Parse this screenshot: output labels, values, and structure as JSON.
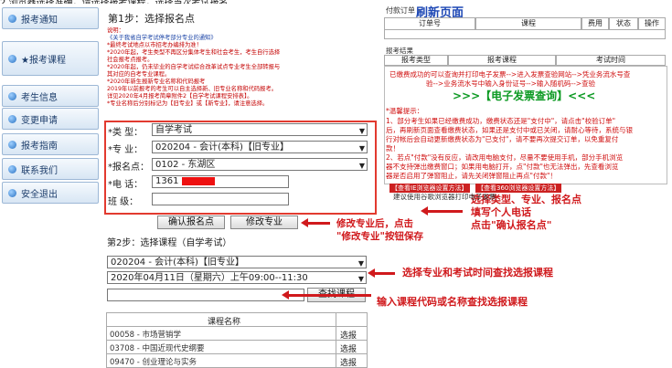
{
  "clipped_top_text": "2.浏览器选择准确，请选择报考课程，选择当次考试报名",
  "sidebar": {
    "items": [
      {
        "label": "报考通知"
      },
      {
        "label": "★报考课程"
      },
      {
        "label": "考生信息"
      },
      {
        "label": "变更申请"
      },
      {
        "label": "报考指南"
      },
      {
        "label": "联系我们"
      },
      {
        "label": "安全退出"
      }
    ]
  },
  "step1": {
    "title": "第1步：选择报名点",
    "notice_lines": [
      "说明：",
      "《关于我省自学考试停考部分专业的通知》",
      "*最终考试地点以市招考办编排为准！",
      "*2020年起，考生类型不再区分集体考生和社会考生，考生自行选择",
      "社会报考点报考。",
      "*2020年起，仍未毕业的自学考试综合改革试点专业考生全部转报与",
      "其对应的自考专业课程。",
      "*2020年新生报新专业名称和代码报考",
      "  2019年以前报考的考生可以自主选择新、旧专业名称和代码报考。",
      "  详见2020年4月报考简章附件2【自学考试课程安排表】。",
      "*专业名称后分别标记为【旧专业】或【新专业】，请注意选择。"
    ],
    "form": {
      "type_label": "*类  型：",
      "type_value": "自学考试",
      "major_label": "*专  业：",
      "major_value": "020204 - 会计(本科)【旧专业】",
      "site_label": "*报名点：",
      "site_value": "0102 - 东湖区",
      "phone_label": "*电  话：",
      "phone_value": "1361",
      "class_label": "班  级："
    },
    "confirm_button": "确认报名点",
    "modify_button": "修改专业"
  },
  "step2": {
    "title": "第2步：选择课程（自学考试）",
    "major_select": "020204 - 会计(本科)【旧专业】",
    "time_select": "2020年04月11日（星期六）上午09:00--11:30",
    "search_input_value": "",
    "search_button": "查找课程",
    "table_header": "课程名称",
    "courses": [
      {
        "name": "00058 - 市场营销学",
        "action": "选报"
      },
      {
        "name": "03708 - 中国近现代史纲要",
        "action": "选报"
      },
      {
        "name": "09470 - 创业理论与实务",
        "action": "选报"
      }
    ]
  },
  "annotations": {
    "modify_note": "修改专业后，点击\n\"修改专业\"按钮保存",
    "select_note": "选择类型、专业、报名点\n填写个人电话\n点击\"确认报名点\"",
    "course_note": "选择专业和考试时间查找选报课程",
    "code_note": "输入课程代码或名称查找选报课程"
  },
  "right_panel": {
    "order_label": "付款订单 -",
    "refresh_label": "刷新页面",
    "order_headers": [
      "订单号",
      "课程",
      "费用",
      "状态",
      "操作"
    ],
    "result_label": "报考结果",
    "result_headers": [
      "报考类型",
      "报考课程",
      "考试时间"
    ],
    "line1": "已缴费成功的可以查询并打印电子发票-->进入发票查验网站-->凭业务流水号查",
    "line2": "验-->业务流水号中输入身份证号-->输入随机码-->查验",
    "invoice_link": ">>>【电子发票查询】<<<",
    "tips_title": "*温馨提示：",
    "tips": [
      "1、部分考生如果已经缴费成功，缴费状态还是\"支付中\"，请点击\"校验订单\"",
      "后，再刷新页面查看缴费状态，如果还是支付中或已关闭，请耐心等待，系统与银",
      "行对帐后会自动更新缴费状态为\"已支付\"，请不要再次提交订单，以免重复付",
      "款！",
      "2、若点\"付款\"没有反应，请改用电脑支付，尽量不要使用手机，部分手机浏览",
      "器不支持弹出缴费窗口；如果用电脑打开，点\"付款\"也无法弹出，先查看浏览",
      "器是否启用了弹窗阻止，请先关闭弹窗阻止再点\"付款\"！"
    ],
    "browser_tag1": "【查看IE浏览器设置方法】",
    "browser_tag2": "【查看360浏览器设置方法】",
    "browser_advice": "建议使用谷歌浏览器打印电子发票"
  }
}
